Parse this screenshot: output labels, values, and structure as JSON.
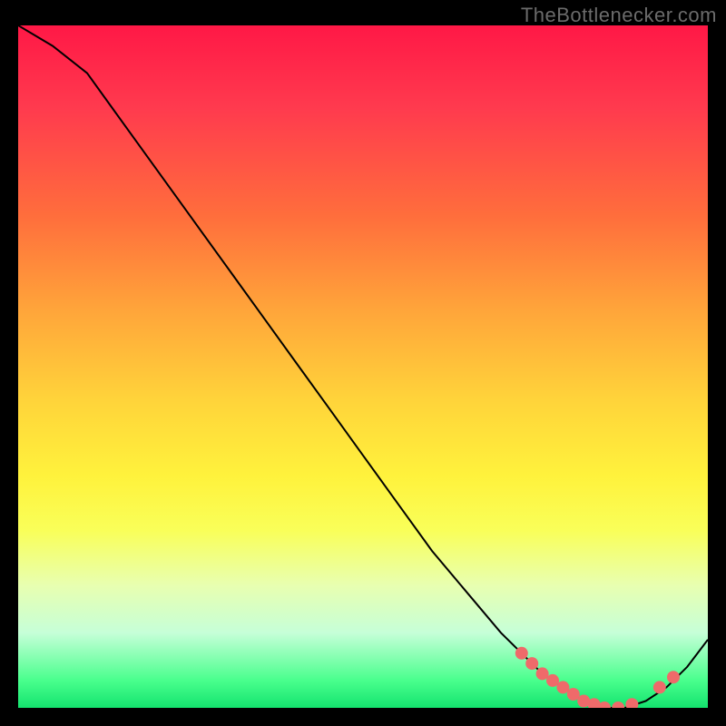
{
  "watermark": "TheBottlenecker.com",
  "chart_data": {
    "type": "line",
    "title": "",
    "xlabel": "",
    "ylabel": "",
    "xlim": [
      0,
      100
    ],
    "ylim": [
      0,
      100
    ],
    "series": [
      {
        "name": "curve",
        "x": [
          0,
          5,
          10,
          15,
          20,
          25,
          30,
          35,
          40,
          45,
          50,
          55,
          60,
          65,
          70,
          73,
          76,
          79,
          82,
          85,
          88,
          91,
          94,
          97,
          100
        ],
        "y": [
          100,
          97,
          93,
          86,
          79,
          72,
          65,
          58,
          51,
          44,
          37,
          30,
          23,
          17,
          11,
          8,
          5,
          3,
          1,
          0,
          0,
          1,
          3,
          6,
          10
        ]
      }
    ],
    "markers": {
      "name": "highlight-dots",
      "x": [
        73,
        74.5,
        76,
        77.5,
        79,
        80.5,
        82,
        83.5,
        85,
        87,
        89,
        93,
        95
      ],
      "y": [
        8,
        6.5,
        5,
        4,
        3,
        2,
        1,
        0.5,
        0,
        0,
        0.5,
        3,
        4.5
      ]
    },
    "background_gradient": {
      "top": "#ff1846",
      "mid": "#ffe63a",
      "bottom": "#14e36e"
    }
  }
}
